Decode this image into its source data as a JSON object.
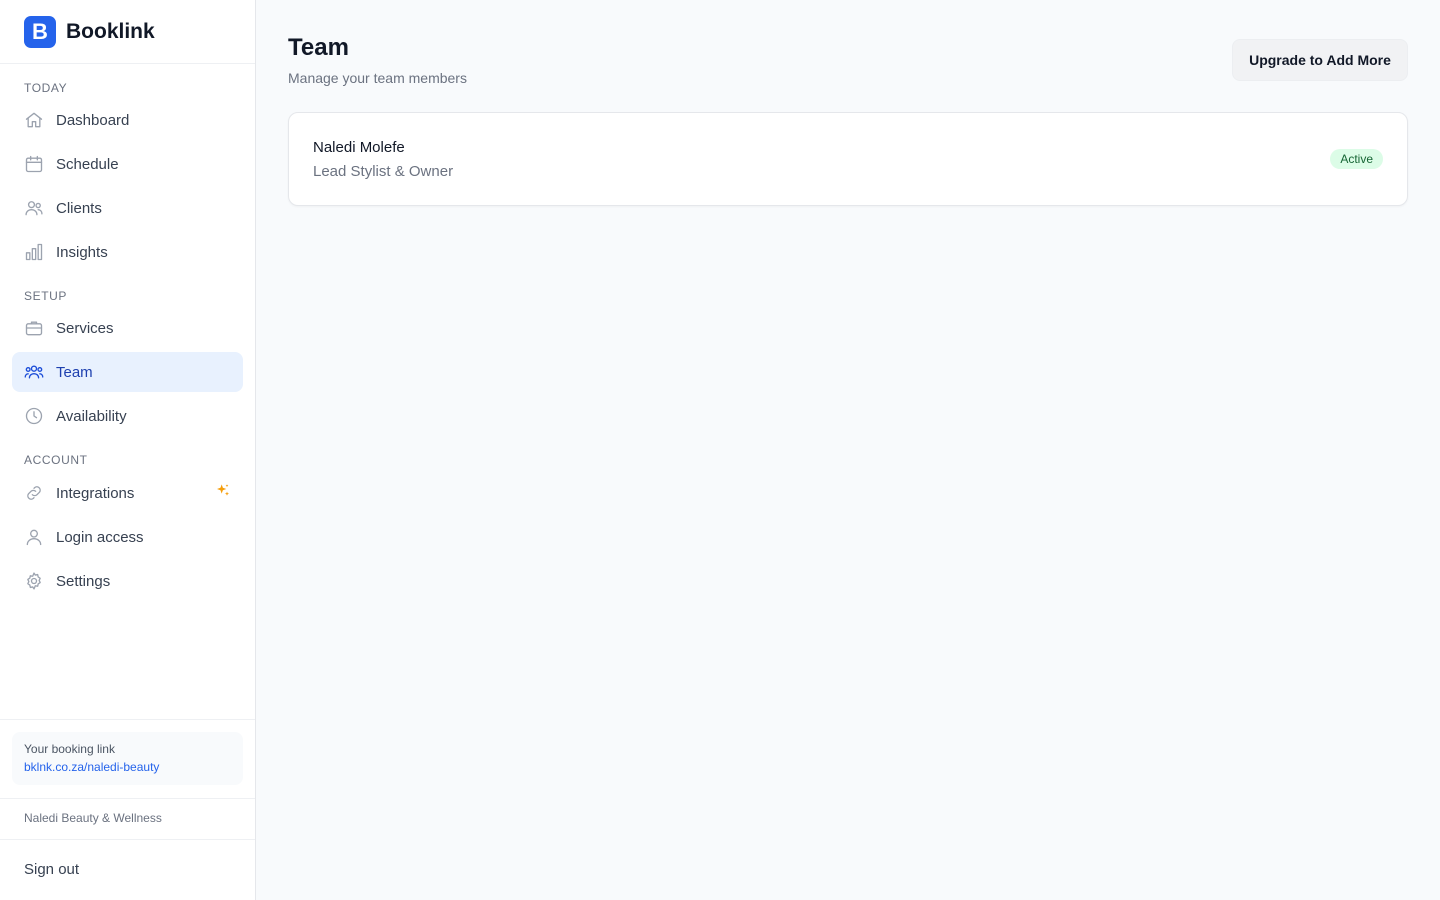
{
  "app": {
    "name": "Booklink",
    "logo_letter": "B",
    "accent": "#2563eb"
  },
  "sidebar": {
    "sections": [
      {
        "label": "Today"
      },
      {
        "label": "Setup"
      },
      {
        "label": "Account"
      }
    ],
    "items": [
      {
        "label": "Dashboard",
        "icon": "home-icon"
      },
      {
        "label": "Schedule",
        "icon": "calendar-icon"
      },
      {
        "label": "Clients",
        "icon": "users-icon"
      },
      {
        "label": "Insights",
        "icon": "bar-chart-icon"
      },
      {
        "label": "Services",
        "icon": "briefcase-icon"
      },
      {
        "label": "Team",
        "icon": "team-icon",
        "active": true
      },
      {
        "label": "Availability",
        "icon": "clock-icon"
      },
      {
        "label": "Integrations",
        "icon": "link-icon",
        "badge_icon": "sparkle-icon"
      },
      {
        "label": "Login access",
        "icon": "user-icon"
      },
      {
        "label": "Settings",
        "icon": "gear-icon"
      }
    ],
    "booking": {
      "title": "Your booking link",
      "link": "bklnk.co.za/naledi-beauty"
    },
    "business_name": "Naledi Beauty & Wellness",
    "sign_out": "Sign out"
  },
  "main": {
    "title": "Team",
    "subtitle": "Manage your team members",
    "upgrade_button": "Upgrade to Add More",
    "members": [
      {
        "name": "Naledi Molefe",
        "role": "Lead Stylist & Owner",
        "status": "Active"
      }
    ]
  }
}
